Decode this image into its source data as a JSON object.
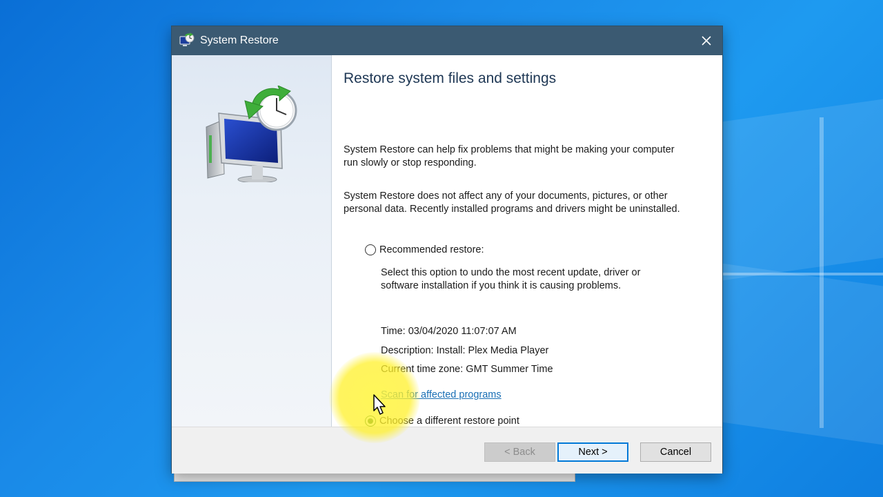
{
  "window": {
    "title": "System Restore",
    "close_glyph": "✕"
  },
  "content": {
    "heading": "Restore system files and settings",
    "intro1": "System Restore can help fix problems that might be making your computer run slowly or stop responding.",
    "intro2": "System Restore does not affect any of your documents, pictures, or other personal data. Recently installed programs and drivers might be uninstalled.",
    "recommended": {
      "label": "Recommended restore:",
      "selected": false,
      "description": "Select this option to undo the most recent update, driver or software installation if you think it is causing problems.",
      "time": "Time: 03/04/2020 11:07:07 AM",
      "restore_description": "Description: Install: Plex Media Player",
      "timezone": "Current time zone: GMT Summer Time",
      "scan_link": "Scan for affected programs"
    },
    "different": {
      "label": "Choose a different restore point",
      "selected": true
    }
  },
  "buttons": {
    "back": "< Back",
    "next": "Next >",
    "cancel": "Cancel"
  },
  "colors": {
    "titlebar": "#3b5a72",
    "heading": "#1e3754",
    "link": "#1a6fb5",
    "default_button_border": "#0078d7",
    "highlight": "#fff23c",
    "desktop": "#1a8ae8"
  },
  "icons": {
    "title": "system-restore-icon",
    "hero": "system-restore-monitor-clock-icon",
    "close": "close-icon",
    "cursor": "mouse-pointer-icon"
  }
}
